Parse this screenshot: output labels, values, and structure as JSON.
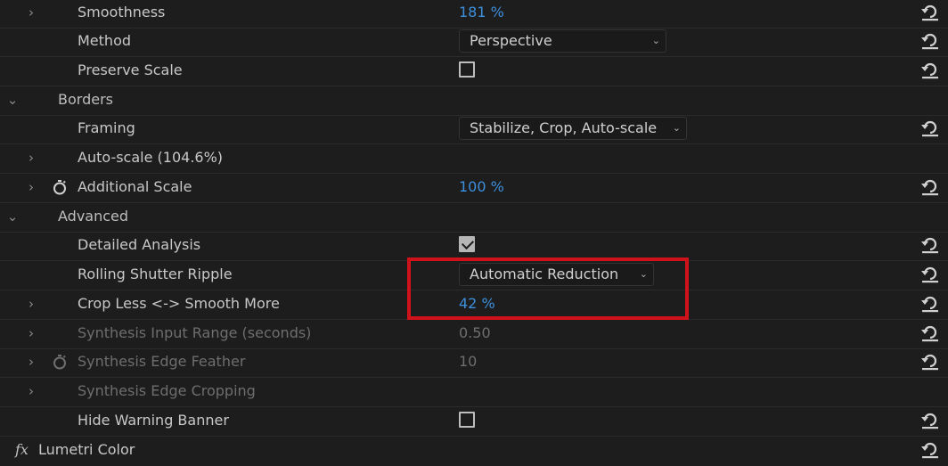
{
  "rows": {
    "smoothness": {
      "label": "Smoothness",
      "value": "181 %"
    },
    "method": {
      "label": "Method",
      "selected": "Perspective"
    },
    "preserve_scale": {
      "label": "Preserve Scale",
      "checked": false
    },
    "borders": {
      "label": "Borders"
    },
    "framing": {
      "label": "Framing",
      "selected": "Stabilize, Crop, Auto-scale"
    },
    "auto_scale": {
      "label": "Auto-scale (104.6%)"
    },
    "additional_scale": {
      "label": "Additional Scale",
      "value": "100 %"
    },
    "advanced": {
      "label": "Advanced"
    },
    "detailed_analysis": {
      "label": "Detailed Analysis",
      "checked": true
    },
    "rolling_shutter": {
      "label": "Rolling Shutter Ripple",
      "selected": "Automatic Reduction"
    },
    "crop_less": {
      "label": "Crop Less <-> Smooth More",
      "value": "42 %"
    },
    "synthesis_input": {
      "label": "Synthesis Input Range (seconds)",
      "value": "0.50"
    },
    "synthesis_feather": {
      "label": "Synthesis Edge Feather",
      "value": "10"
    },
    "synthesis_cropping": {
      "label": "Synthesis Edge Cropping"
    },
    "hide_warning": {
      "label": "Hide Warning Banner",
      "checked": false
    },
    "lumetri": {
      "fx_label": "fx",
      "label": "Lumetri Color"
    }
  },
  "icons": {
    "expand": "chevron-right-icon",
    "collapse": "chevron-down-icon",
    "reset": "reset-icon",
    "stopwatch": "stopwatch-icon"
  },
  "colors": {
    "background": "#1d1d1d",
    "value_link": "#3d8fdc",
    "highlight": "#d0121b",
    "disabled_text": "#6e6e6e"
  }
}
